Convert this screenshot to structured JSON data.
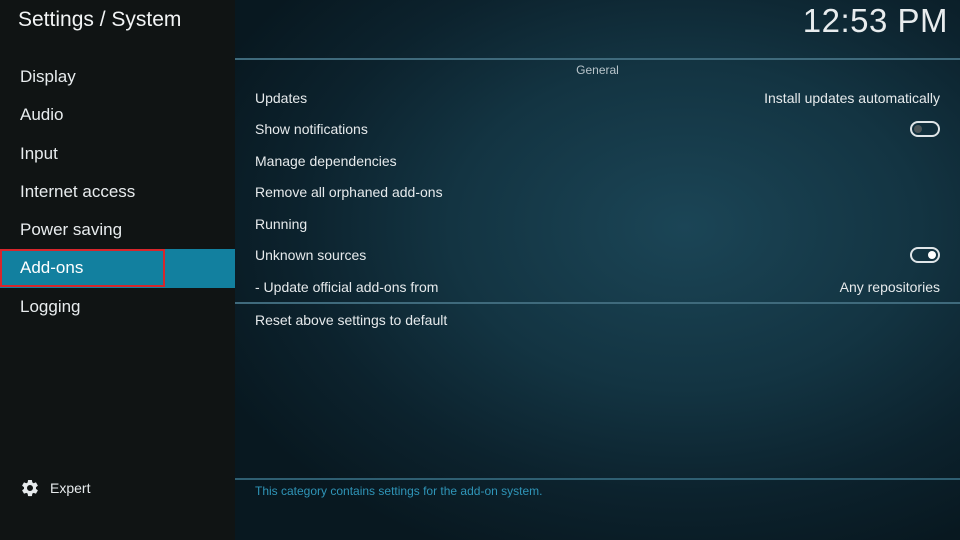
{
  "header": {
    "title": "Settings / System",
    "clock": "12:53 PM"
  },
  "sidebar": {
    "items": [
      {
        "label": "Display"
      },
      {
        "label": "Audio"
      },
      {
        "label": "Input"
      },
      {
        "label": "Internet access"
      },
      {
        "label": "Power saving"
      },
      {
        "label": "Add-ons",
        "selected": true
      },
      {
        "label": "Logging"
      }
    ],
    "expert": {
      "icon": "gear-icon",
      "label": "Expert"
    }
  },
  "main": {
    "section_title": "General",
    "settings": [
      {
        "label": "Updates",
        "value": "Install updates automatically"
      },
      {
        "label": "Show notifications",
        "toggle": "off"
      },
      {
        "label": "Manage dependencies"
      },
      {
        "label": "Remove all orphaned add-ons"
      },
      {
        "label": "Running"
      },
      {
        "label": "Unknown sources",
        "toggle": "on"
      },
      {
        "label": "- Update official add-ons from",
        "value": "Any repositories"
      }
    ],
    "reset_label": "Reset above settings to default",
    "help_text": "This category contains settings for the add-on system."
  },
  "colors": {
    "accent": "#12809f",
    "focus_border": "#d8262c",
    "help_text": "#2f95b8"
  }
}
